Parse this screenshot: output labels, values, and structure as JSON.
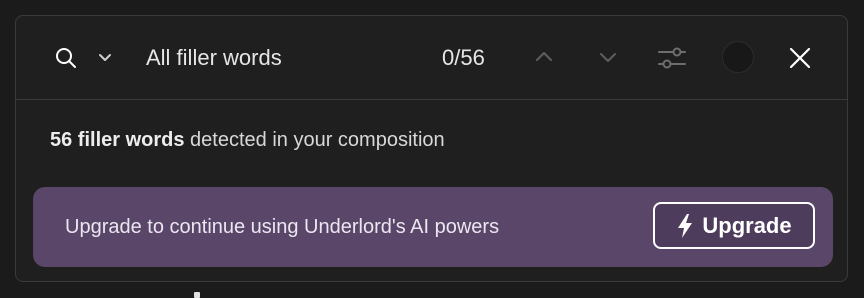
{
  "search": {
    "query": "All filler words",
    "counter": "0/56",
    "icons": {
      "search": "search-icon",
      "dropdown": "chevron-down-icon",
      "prev": "chevron-up-icon",
      "next": "chevron-down-icon",
      "filter": "sliders-icon",
      "close": "close-icon"
    }
  },
  "summary": {
    "bold": "56 filler words",
    "rest": " detected in your composition"
  },
  "banner": {
    "text": "Upgrade to continue using Underlord's AI powers",
    "button_label": "Upgrade",
    "button_icon": "lightning-bolt-icon",
    "color": "#594669"
  },
  "colors": {
    "background": "#1b1b1b",
    "panel": "#1f1f1f",
    "border": "#3a3a3a",
    "text": "#e6e6e6",
    "muted_icon": "#6e6e6e"
  }
}
